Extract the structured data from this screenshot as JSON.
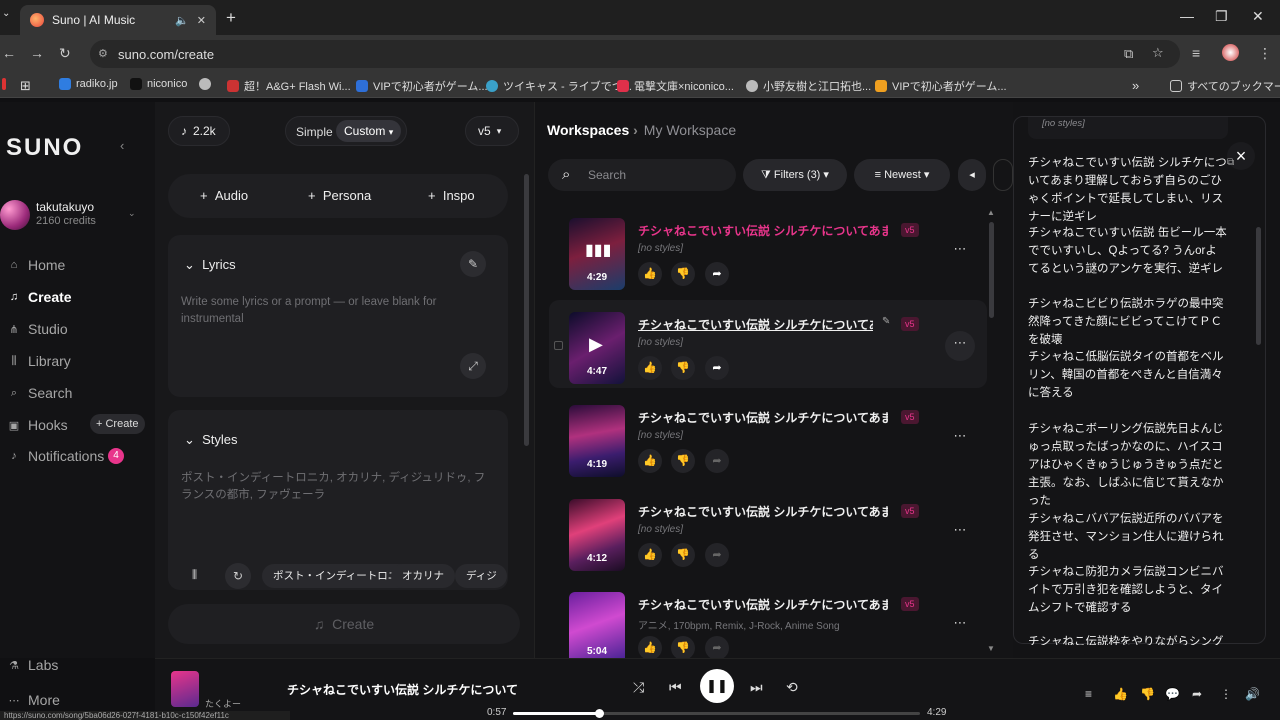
{
  "browser": {
    "tab_title": "Suno | AI Music",
    "url": "suno.com/create",
    "bookmarks": [
      "radiko.jp",
      "niconico",
      "",
      "超！A&G+ Flash Wi...",
      "VIPで初心者がゲーム...",
      "ツイキャス - ライブでつ...",
      "電撃文庫×niconico...",
      "小野友樹と江口拓也...",
      "VIPで初心者がゲーム..."
    ],
    "bookmarks_folder": "すべてのブックマーク",
    "status_url": "https://suno.com/song/5ba06d26-027f-4181-b10c-c150f42ef11c"
  },
  "sidebar": {
    "logo": "SUNO",
    "username": "takutakuyo",
    "credits": "2160 credits",
    "nav": [
      "Home",
      "Create",
      "Studio",
      "Library",
      "Search",
      "Hooks",
      "Notifications"
    ],
    "hooks_create": "+ Create",
    "notifications_count": "4",
    "labs": "Labs",
    "more": "More"
  },
  "compose": {
    "credits_pill": "2.2k",
    "mode_simple": "Simple",
    "mode_custom": "Custom",
    "model": "v5",
    "add_audio": "Audio",
    "add_persona": "Persona",
    "add_inspo": "Inspo",
    "lyrics_header": "Lyrics",
    "lyrics_placeholder": "Write some lyrics or a prompt — or leave blank for instrumental",
    "styles_header": "Styles",
    "styles_placeholder": "ポスト・インディートロニカ, オカリナ, ディジュリドゥ, フランスの都市, ファヴェーラ",
    "tags": [
      "ポスト・インディートロニカ",
      "オカリナ",
      "ディジ"
    ],
    "create_button": "Create"
  },
  "workspace": {
    "crumb_root": "Workspaces",
    "crumb_current": "My Workspace",
    "search_placeholder": "Search",
    "filters": "Filters (3)",
    "sort": "Newest",
    "songs": [
      {
        "title": "チシャねこでいすい伝説 シルチケについてあまり理解...",
        "style": "[no styles]",
        "duration": "4:29",
        "badge": "v5"
      },
      {
        "title": "チシャねこでいすい伝説 シルチケについてあまり理...",
        "style": "[no styles]",
        "duration": "4:47",
        "badge": "v5"
      },
      {
        "title": "チシャねこでいすい伝説 シルチケについてあまり理解...",
        "style": "[no styles]",
        "duration": "4:19",
        "badge": "v5"
      },
      {
        "title": "チシャねこでいすい伝説 シルチケについてあまり理解...",
        "style": "[no styles]",
        "duration": "4:12",
        "badge": "v5"
      },
      {
        "title": "チシャねこでいすい伝説 シルチケについてあまり理解...",
        "style": "アニメ, 170bpm, Remix, J-Rock, Anime Song",
        "duration": "5:04",
        "badge": "v5"
      }
    ]
  },
  "lyrics_panel": {
    "top_style": "[no styles]",
    "paragraphs": [
      "チシャねこでいすい伝説 シルチケについてあまり理解しておらず自らのごひゃくポイントで延長してしまい、リスナーに逆ギレ",
      "チシャねこでいすい伝説 缶ビール一本ででいすいし、Qよってる? うんorよてるという謎のアンケを実行、逆ギレ",
      "チシャねこビビり伝説ホラゲの最中突然降ってきた顔にビビってこけてＰＣを破壊",
      "チシャねこ低脳伝説タイの首都をベルリン、韓国の首都をぺきんと自信満々に答える",
      "チシャねこボーリング伝説先日よんじゅっ点取ったばっかなのに、ハイスコアはひゃくきゅうじゅうきゅう点だと主張。なお、しばふに信じて貰えなかった",
      "チシャねこババア伝説近所のババアを発狂させ、マンション住人に避けられる",
      "チシャねこ防犯カメラ伝説コンビニバイトで万引き犯を確認しようと、タイムシフトで確認する",
      "チシャねこ伝説枠をやりながらシングル..."
    ]
  },
  "player": {
    "artist": "たくよー",
    "title": "チシャねこでいすい伝説 シルチケについて",
    "elapsed": "0:57",
    "total": "4:29",
    "progress": 0.212
  }
}
